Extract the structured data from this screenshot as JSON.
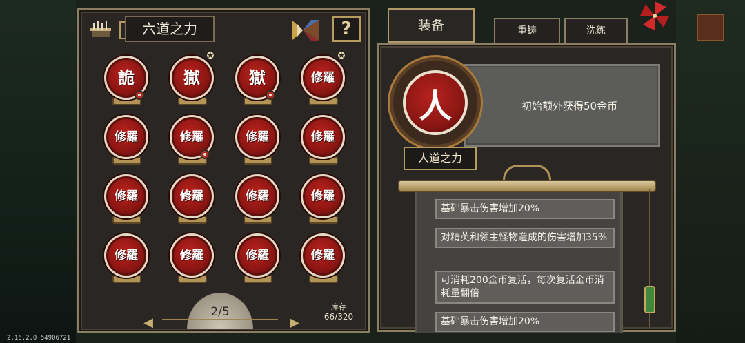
{
  "left_panel": {
    "title": "六道之力",
    "help_label": "?",
    "grid": [
      {
        "glyph": "詭",
        "star": false,
        "dot": true
      },
      {
        "glyph": "獄",
        "star": true,
        "dot": false
      },
      {
        "glyph": "獄",
        "star": false,
        "dot": true
      },
      {
        "glyph": "修羅",
        "star": true,
        "dot": false
      },
      {
        "glyph": "修羅",
        "star": false,
        "dot": false
      },
      {
        "glyph": "修羅",
        "star": false,
        "dot": true
      },
      {
        "glyph": "修羅",
        "star": false,
        "dot": false
      },
      {
        "glyph": "修羅",
        "star": false,
        "dot": false
      },
      {
        "glyph": "修羅",
        "star": false,
        "dot": false
      },
      {
        "glyph": "修羅",
        "star": false,
        "dot": false
      },
      {
        "glyph": "修羅",
        "star": false,
        "dot": false
      },
      {
        "glyph": "修羅",
        "star": false,
        "dot": false
      },
      {
        "glyph": "修羅",
        "star": false,
        "dot": false
      },
      {
        "glyph": "修羅",
        "star": false,
        "dot": false
      },
      {
        "glyph": "修羅",
        "star": false,
        "dot": false
      },
      {
        "glyph": "修羅",
        "star": false,
        "dot": false
      }
    ],
    "page": "2/5",
    "stock_label": "库存",
    "stock_value": "66/320"
  },
  "tabs": {
    "equip": "装备",
    "recast": "重铸",
    "refine": "洗练"
  },
  "detail": {
    "glyph": "人",
    "name": "人道之力",
    "description": "初始额外获得50金币",
    "effects": [
      "基础暴击伤害增加20%",
      "对精英和领主怪物造成的伤害增加35%",
      "可消耗200金币复活，每次复活金币消耗量翻倍",
      "基础暴击伤害增加20%"
    ]
  },
  "version": "2.16.2.0 54906721",
  "colors": {
    "orb_red": "#8d1613",
    "panel_bg": "#2a2623",
    "frame": "#8c7e63",
    "gold": "#b79c5f"
  }
}
